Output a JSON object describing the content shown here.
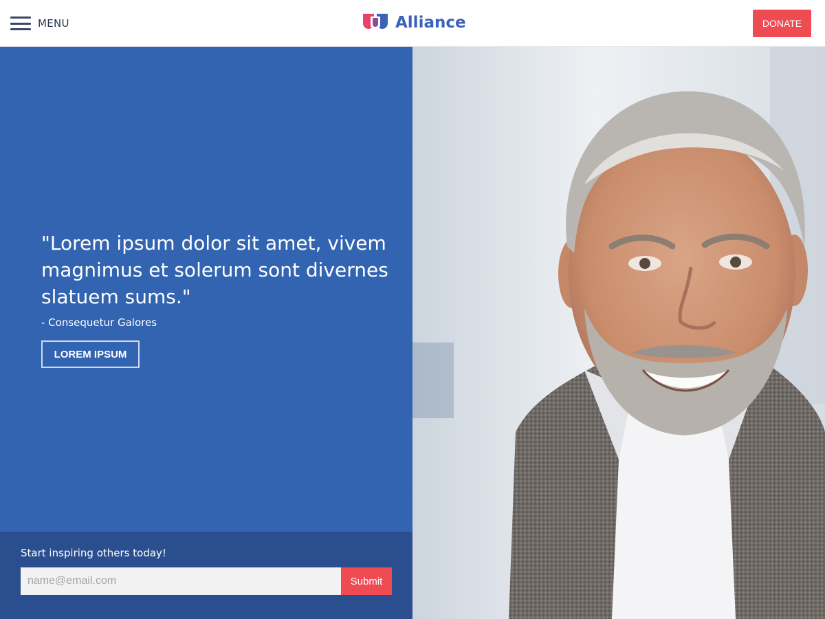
{
  "header": {
    "menu_label": "MENU",
    "menu_icon": "hamburger-icon",
    "brand_name": "Alliance",
    "brand_icon": "alliance-logo",
    "donate_label": "DONATE"
  },
  "hero": {
    "quote": "\"Lorem ipsum dolor sit amet, vivem magnimus et solerum sont divernes slatuem sums.\"",
    "author": "- Consequetur Galores",
    "cta_label": "LOREM IPSUM"
  },
  "signup": {
    "title": "Start inspiring others today!",
    "email_placeholder": "name@email.com",
    "email_value": "",
    "submit_label": "Submit"
  },
  "colors": {
    "primary_blue": "#3264b1",
    "dark_blue": "#2b4f8e",
    "accent_red": "#ef4b53",
    "logo_pink": "#e8436b",
    "logo_blue": "#3a63b7"
  }
}
